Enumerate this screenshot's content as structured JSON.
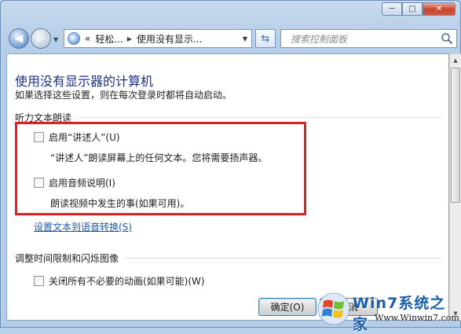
{
  "window": {
    "caption_buttons": {
      "minimize": "─",
      "maximize": "□",
      "close": "✕"
    }
  },
  "navbar": {
    "address_parts": [
      "«",
      "轻松...",
      "使用没有显示..."
    ],
    "search_placeholder": "搜索控制面板"
  },
  "page": {
    "title": "使用没有显示器的计算机",
    "description": "如果选择这些设置，则在每次登录时都将自动启动。"
  },
  "sections": [
    {
      "heading": "听力文本朗读",
      "options": [
        {
          "label": "启用“讲述人”(U)",
          "checked": false,
          "description": "“讲述人”朗读屏幕上的任何文本。您将需要扬声器。"
        },
        {
          "label": "启用音频说明(I)",
          "checked": false,
          "description": "朗读视频中发生的事(如果可用)。"
        }
      ],
      "link": "设置文本到语音转换(S)"
    },
    {
      "heading": "调整时间限制和闪烁图像",
      "options": [
        {
          "label": "关闭所有不必要的动画(如果可能)(W)",
          "checked": false
        }
      ]
    }
  ],
  "buttons": {
    "ok": "确定(O)",
    "cancel": "取消"
  },
  "watermark": {
    "brand": "Win7系统之家",
    "url": "Www.Winwin7.com"
  },
  "colors": {
    "title": "#1e3287",
    "link": "#1e5aa8",
    "highlight": "#e02020"
  }
}
